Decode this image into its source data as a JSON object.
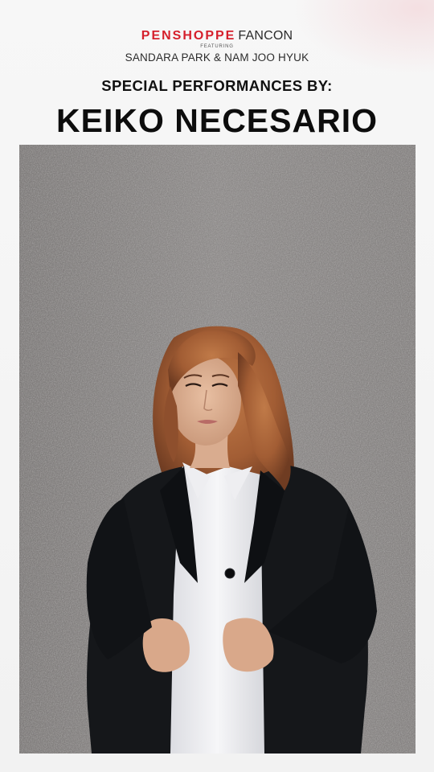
{
  "poster": {
    "brand": "PENSHOPPE",
    "brand_suffix": "FANCON",
    "featuring": "FEATURING",
    "artists": "SANDARA PARK & NAM JOO HYUK",
    "subtitle": "SPECIAL PERFORMANCES BY:",
    "performer": "KEIKO NECESARIO"
  },
  "colors": {
    "brand_red": "#d51f2b",
    "text_dark": "#111111",
    "wall_gray": "#8a8786",
    "blazer_black": "#15171a",
    "shirt_white": "#f2f2f4",
    "hair_auburn": "#a8643a"
  },
  "photo": {
    "subject": "portrait-of-performer"
  }
}
